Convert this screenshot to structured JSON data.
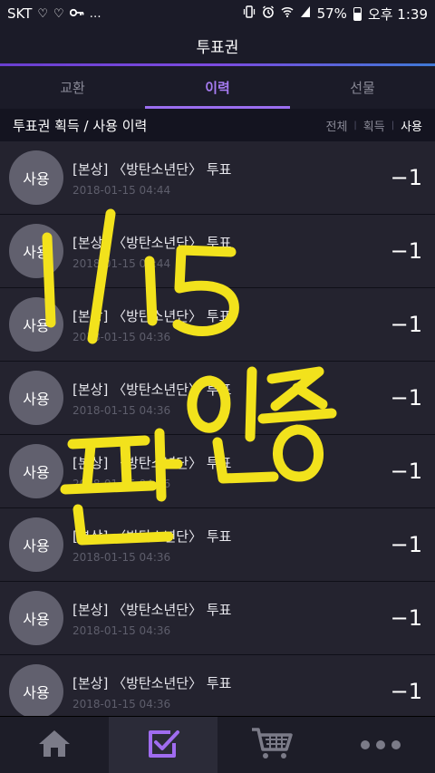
{
  "status": {
    "carrier": "SKT",
    "battery": "57%",
    "battery_level": 0.57,
    "time": "오후 1:39",
    "left_icons": [
      "heart-outline-icon",
      "heart-outline-icon",
      "key-icon",
      "more-dots-icon"
    ],
    "right_icons": [
      "vibrate-icon",
      "alarm-icon",
      "wifi-icon",
      "signal-icon",
      "battery-icon"
    ]
  },
  "header": {
    "title": "투표권"
  },
  "tabs": [
    {
      "label": "교환",
      "active": false
    },
    {
      "label": "이력",
      "active": true
    },
    {
      "label": "선물",
      "active": false
    }
  ],
  "subheader": {
    "title": "투표권 획득 / 사용 이력",
    "filters": [
      "전체",
      "획득",
      "사용"
    ],
    "active_filter": "사용"
  },
  "items": [
    {
      "badge": "사용",
      "title": "[본상] 〈방탄소년단〉 투표",
      "date": "2018-01-15 04:44",
      "amount": "−1"
    },
    {
      "badge": "사용",
      "title": "[본상] 〈방탄소년단〉 투표",
      "date": "2018-01-15 04:44",
      "amount": "−1"
    },
    {
      "badge": "사용",
      "title": "[본상] 〈방탄소년단〉 투표",
      "date": "2018-01-15 04:36",
      "amount": "−1"
    },
    {
      "badge": "사용",
      "title": "[본상] 〈방탄소년단〉 투표",
      "date": "2018-01-15 04:36",
      "amount": "−1"
    },
    {
      "badge": "사용",
      "title": "[본상] 〈방탄소년단〉 투표",
      "date": "2018-01-15 04:36",
      "amount": "−1"
    },
    {
      "badge": "사용",
      "title": "[본상] 〈방탄소년단〉 투표",
      "date": "2018-01-15 04:36",
      "amount": "−1"
    },
    {
      "badge": "사용",
      "title": "[본상] 〈방탄소년단〉 투표",
      "date": "2018-01-15 04:36",
      "amount": "−1"
    },
    {
      "badge": "사용",
      "title": "[본상] 〈방탄소년단〉 투표",
      "date": "2018-01-15 04:36",
      "amount": "−1"
    }
  ],
  "handwriting": {
    "line1": "1/15",
    "line2": "판인증",
    "color": "#f2e21c"
  },
  "nav": [
    {
      "icon": "home-icon",
      "active": false
    },
    {
      "icon": "vote-check-icon",
      "active": true
    },
    {
      "icon": "cart-icon",
      "active": false
    },
    {
      "icon": "more-icon",
      "active": false
    }
  ],
  "colors": {
    "accent": "#9b6ef0",
    "background": "#1b1b28",
    "row": "#24232f",
    "badge": "#61606e"
  }
}
